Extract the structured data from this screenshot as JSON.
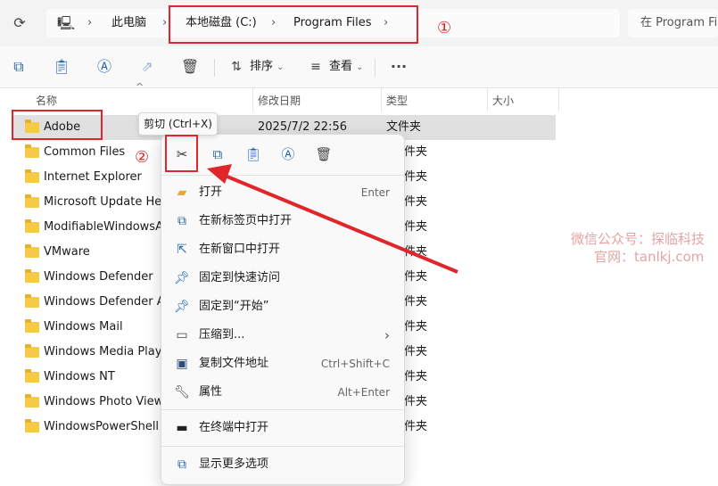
{
  "address_bar": {
    "crumbs": [
      "此电脑",
      "本地磁盘 (C:)",
      "Program Files"
    ],
    "search_placeholder": "在 Program Files"
  },
  "toolbar": {
    "sort_label": "排序",
    "view_label": "查看"
  },
  "columns": {
    "name": "名称",
    "date": "修改日期",
    "type": "类型",
    "size": "大小"
  },
  "files": [
    {
      "name": "Adobe",
      "date": "2025/7/2 22:56",
      "type": "文件夹"
    },
    {
      "name": "Common Files",
      "type": "件夹"
    },
    {
      "name": "Internet Explorer",
      "type": "件夹"
    },
    {
      "name": "Microsoft Update Hea",
      "type": "件夹"
    },
    {
      "name": "ModifiableWindowsAp",
      "type": "件夹"
    },
    {
      "name": "VMware",
      "type": "件夹"
    },
    {
      "name": "Windows Defender",
      "type": "件夹"
    },
    {
      "name": "Windows Defender Ad",
      "type": "件夹"
    },
    {
      "name": "Windows Mail",
      "type": "件夹"
    },
    {
      "name": "Windows Media Player",
      "type": "件夹"
    },
    {
      "name": "Windows NT",
      "type": "件夹"
    },
    {
      "name": "Windows Photo Viewe",
      "type": "件夹"
    },
    {
      "name": "WindowsPowerShell",
      "type": "件夹"
    }
  ],
  "tooltip": "剪切 (Ctrl+X)",
  "context_menu": {
    "items": [
      {
        "label": "打开",
        "shortcut": "Enter"
      },
      {
        "label": "在新标签页中打开",
        "shortcut": ""
      },
      {
        "label": "在新窗口中打开",
        "shortcut": ""
      },
      {
        "label": "固定到快速访问",
        "shortcut": ""
      },
      {
        "label": "固定到“开始”",
        "shortcut": ""
      },
      {
        "label": "压缩到...",
        "shortcut": ""
      },
      {
        "label": "复制文件地址",
        "shortcut": "Ctrl+Shift+C"
      },
      {
        "label": "属性",
        "shortcut": "Alt+Enter"
      },
      {
        "label": "在终端中打开",
        "shortcut": ""
      },
      {
        "label": "显示更多选项",
        "shortcut": ""
      }
    ]
  },
  "annotations": {
    "marker1": "①",
    "marker2": "②"
  },
  "watermark": {
    "line1": "微信公众号：探临科技",
    "line2": "官网：tanlkj.com"
  },
  "colors": {
    "accent": "#2566b3",
    "annotation": "#e0262a",
    "folder": "#f7c948"
  }
}
